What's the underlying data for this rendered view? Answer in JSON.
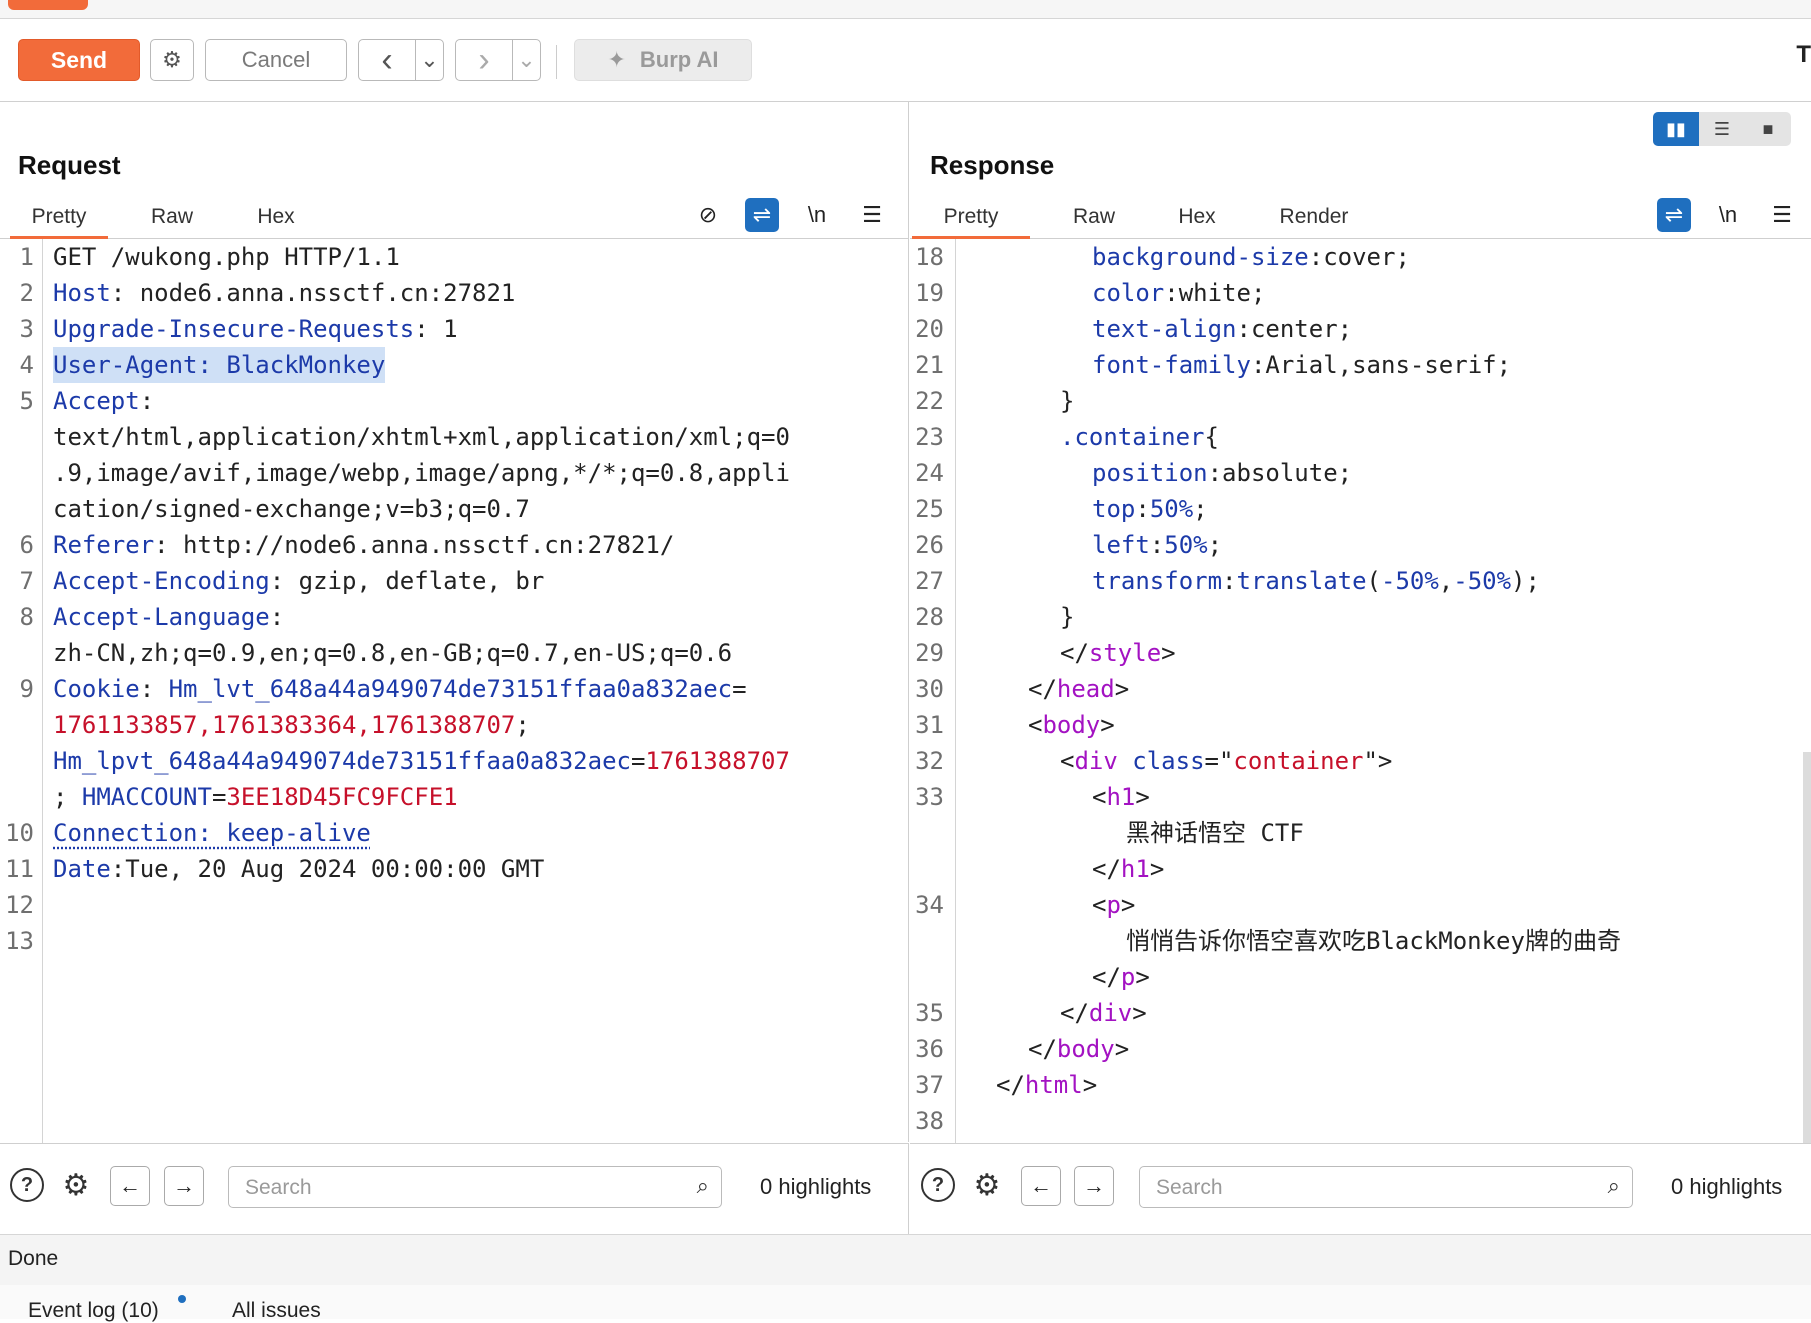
{
  "toolbar": {
    "send_label": "Send",
    "cancel_label": "Cancel",
    "back_symbol": "‹",
    "forward_symbol": "›",
    "dropdown_symbol": "⌄",
    "ai_label": "Burp AI",
    "right_letter": "T"
  },
  "request": {
    "title": "Request",
    "tabs": [
      "Pretty",
      "Raw",
      "Hex"
    ],
    "lines": {
      "l1": {
        "n": "1",
        "text": "GET /wukong.php HTTP/1.1"
      },
      "l2": {
        "n": "2",
        "k": "Host",
        "v": ": node6.anna.nssctf.cn:27821"
      },
      "l3": {
        "n": "3",
        "k": "Upgrade-Insecure-Requests",
        "v": ": 1"
      },
      "l4": {
        "n": "4",
        "text": "User-Agent: BlackMonkey"
      },
      "l5": {
        "n": "5",
        "k": "Accept",
        "v": ":"
      },
      "l5b": "text/html,application/xhtml+xml,application/xml;q=0",
      "l5c": ".9,image/avif,image/webp,image/apng,*/*;q=0.8,appli",
      "l5d": "cation/signed-exchange;v=b3;q=0.7",
      "l6": {
        "n": "6",
        "k": "Referer",
        "v": ": http://node6.anna.nssctf.cn:27821/"
      },
      "l7": {
        "n": "7",
        "k": "Accept-Encoding",
        "v": ": gzip, deflate, br"
      },
      "l8": {
        "n": "8",
        "k": "Accept-Language",
        "v": ":"
      },
      "l8b": "zh-CN,zh;q=0.9,en;q=0.8,en-GB;q=0.7,en-US;q=0.6",
      "l9": {
        "n": "9",
        "k": "Cookie",
        "sep": ": ",
        "ck1": "Hm_lvt_648a44a949074de73151ffaa0a832aec",
        "eq": "="
      },
      "l9b": "1761133857,1761383364,1761388707",
      "l9b_semi": ";",
      "l9c_k": "Hm_lpvt_648a44a949074de73151ffaa0a832aec",
      "l9c_eq": "=",
      "l9c_v": "1761388707",
      "l9d_pre": "; ",
      "l9d_k": "HMACCOUNT",
      "l9d_eq": "=",
      "l9d_v": "3EE18D45FC9FCFE1",
      "l10": {
        "n": "10",
        "text": "Connection: keep-alive"
      },
      "l11": {
        "n": "11",
        "k": "Date",
        "v": ":Tue, 20 Aug 2024 00:00:00 GMT"
      },
      "l12": {
        "n": "12"
      },
      "l13": {
        "n": "13"
      }
    },
    "search_placeholder": "Search",
    "highlights": "0 highlights"
  },
  "response": {
    "title": "Response",
    "tabs": [
      "Pretty",
      "Raw",
      "Hex",
      "Render"
    ],
    "lines": {
      "r18": {
        "n": "18",
        "p": "background-size",
        "v": ":cover;"
      },
      "r19": {
        "n": "19",
        "p": "color",
        "v": ":white;"
      },
      "r20": {
        "n": "20",
        "p": "text-align",
        "v": ":center;"
      },
      "r21": {
        "n": "21",
        "p": "font-family",
        "v": ":Arial,sans-serif;"
      },
      "r22": {
        "n": "22",
        "t": "}"
      },
      "r23": {
        "n": "23",
        "sel": ".container",
        "t": "{"
      },
      "r24": {
        "n": "24",
        "p": "position",
        "v": ":absolute;"
      },
      "r25": {
        "n": "25",
        "p": "top",
        "c": ":",
        "num": "50%",
        "e": ";"
      },
      "r26": {
        "n": "26",
        "p": "left",
        "c": ":",
        "num": "50%",
        "e": ";"
      },
      "r27": {
        "n": "27",
        "p": "transform",
        "c": ":",
        "fn": "translate",
        "o": "(",
        "a1": "-50%",
        "cm": ",",
        "a2": "-50%",
        "e": ");"
      },
      "r28": {
        "n": "28",
        "t": "}"
      },
      "r29": {
        "n": "29",
        "lt": "</",
        "tg": "style",
        "gt": ">"
      },
      "r30": {
        "n": "30",
        "lt": "</",
        "tg": "head",
        "gt": ">"
      },
      "r31": {
        "n": "31",
        "lt": "<",
        "tg": "body",
        "gt": ">"
      },
      "r32": {
        "n": "32",
        "lt": "<",
        "tg": "div",
        "sp": " ",
        "an": "class",
        "eq": "=\"",
        "av": "container",
        "q": "\">"
      },
      "r33": {
        "n": "33",
        "lt": "<",
        "tg": "h1",
        "gt": ">"
      },
      "r33b": "黑神话悟空 CTF",
      "r33c": {
        "lt": "</",
        "tg": "h1",
        "gt": ">"
      },
      "r34": {
        "n": "34",
        "lt": "<",
        "tg": "p",
        "gt": ">"
      },
      "r34b": "悄悄告诉你悟空喜欢吃BlackMonkey牌的曲奇",
      "r34c": {
        "lt": "</",
        "tg": "p",
        "gt": ">"
      },
      "r35": {
        "n": "35",
        "lt": "</",
        "tg": "div",
        "gt": ">"
      },
      "r36": {
        "n": "36",
        "lt": "</",
        "tg": "body",
        "gt": ">"
      },
      "r37": {
        "n": "37",
        "lt": "</",
        "tg": "html",
        "gt": ">"
      },
      "r38": {
        "n": "38"
      }
    },
    "search_placeholder": "Search",
    "highlights": "0 highlights"
  },
  "icons": {
    "gear": "⚙",
    "help": "?",
    "left": "←",
    "right": "→",
    "search": "⌕",
    "newline": "\\n",
    "menu": "☰",
    "wrap": "⇌",
    "hide": "⊘",
    "spark": "✦",
    "layout_split": "▮▮",
    "layout_rows": "☰",
    "layout_single": "■"
  },
  "status": "Done",
  "footer": {
    "event_log": "Event log (10)",
    "all_issues": "All issues"
  },
  "colors": {
    "accent": "#f26b3a",
    "blue": "#1f6fbf",
    "key": "#1c3aa9",
    "cookie_value": "#c6102a",
    "tag": "#a312c2"
  }
}
